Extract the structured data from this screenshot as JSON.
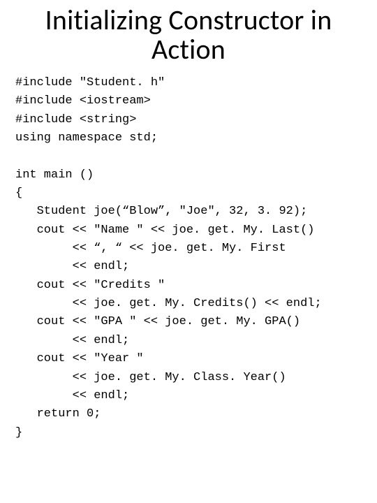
{
  "title": "Initializing Constructor in Action",
  "code_lines": [
    "#include \"Student. h\"",
    "#include <iostream>",
    "#include <string>",
    "using namespace std;",
    "",
    "int main ()",
    "{",
    "   Student joe(“Blow”, \"Joe\", 32, 3. 92);",
    "   cout << \"Name \" << joe. get. My. Last()",
    "        << “, “ << joe. get. My. First",
    "        << endl;",
    "   cout << \"Credits \"",
    "        << joe. get. My. Credits() << endl;",
    "   cout << \"GPA \" << joe. get. My. GPA()",
    "        << endl;",
    "   cout << \"Year \"",
    "        << joe. get. My. Class. Year()",
    "        << endl;",
    "   return 0;",
    "}"
  ]
}
